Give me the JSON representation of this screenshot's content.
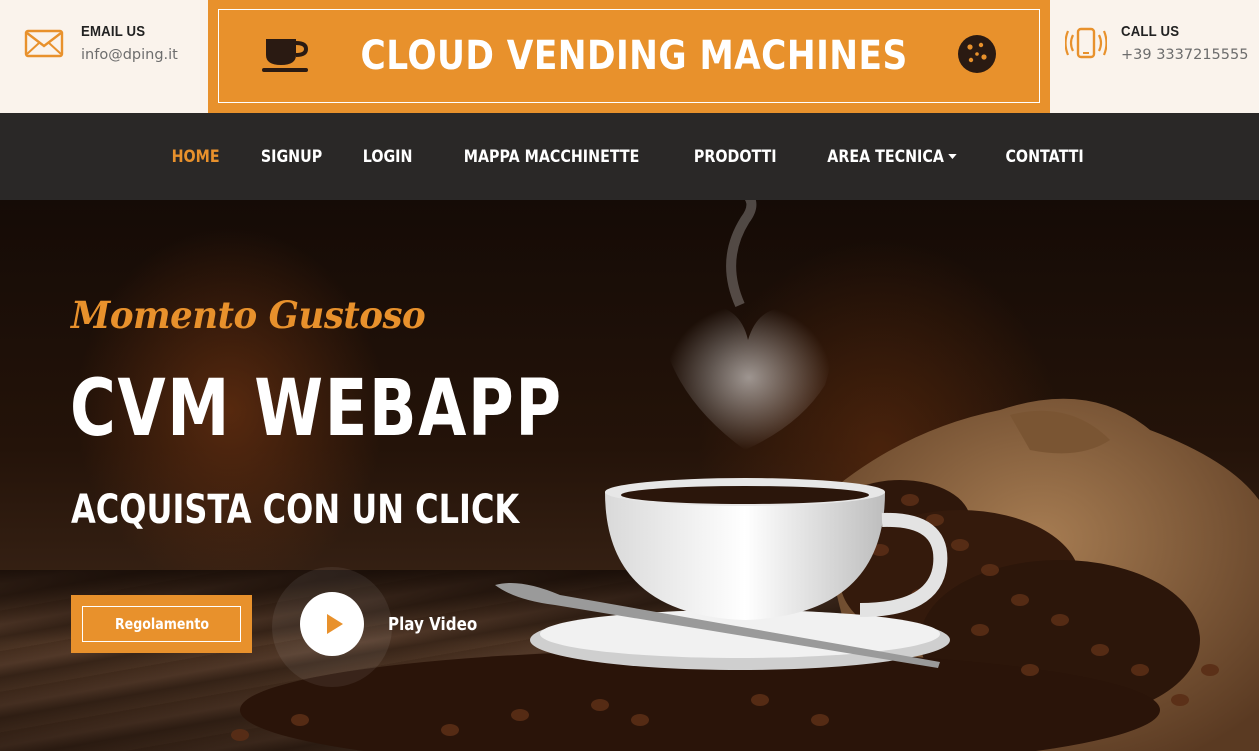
{
  "contact_email": {
    "label": "EMAIL US",
    "value": "info@dping.it",
    "icon": "envelope-icon"
  },
  "contact_phone": {
    "label": "CALL US",
    "value": "+39 3337215555",
    "icon": "phone-icon"
  },
  "brand": {
    "title": "CLOUD VENDING MACHINES",
    "left_icon": "coffee-cup-icon",
    "right_icon": "cookie-icon"
  },
  "nav": {
    "items": [
      {
        "label": "HOME",
        "active": true
      },
      {
        "label": "SIGNUP"
      },
      {
        "label": "LOGIN"
      },
      {
        "label": "MAPPA MACCHINETTE"
      },
      {
        "label": "PRODOTTI"
      },
      {
        "label": "AREA TECNICA",
        "dropdown": true
      },
      {
        "label": "CONTATTI"
      }
    ]
  },
  "hero": {
    "tagline": "Momento Gustoso",
    "title": "CVM WEBAPP",
    "subtitle": "ACQUISTA CON UN CLICK",
    "primary_button": "Regolamento",
    "video_label": "Play Video"
  },
  "colors": {
    "accent": "#e8912c",
    "nav_bg": "#2a2827",
    "topbar_bg": "#faf3ec"
  }
}
